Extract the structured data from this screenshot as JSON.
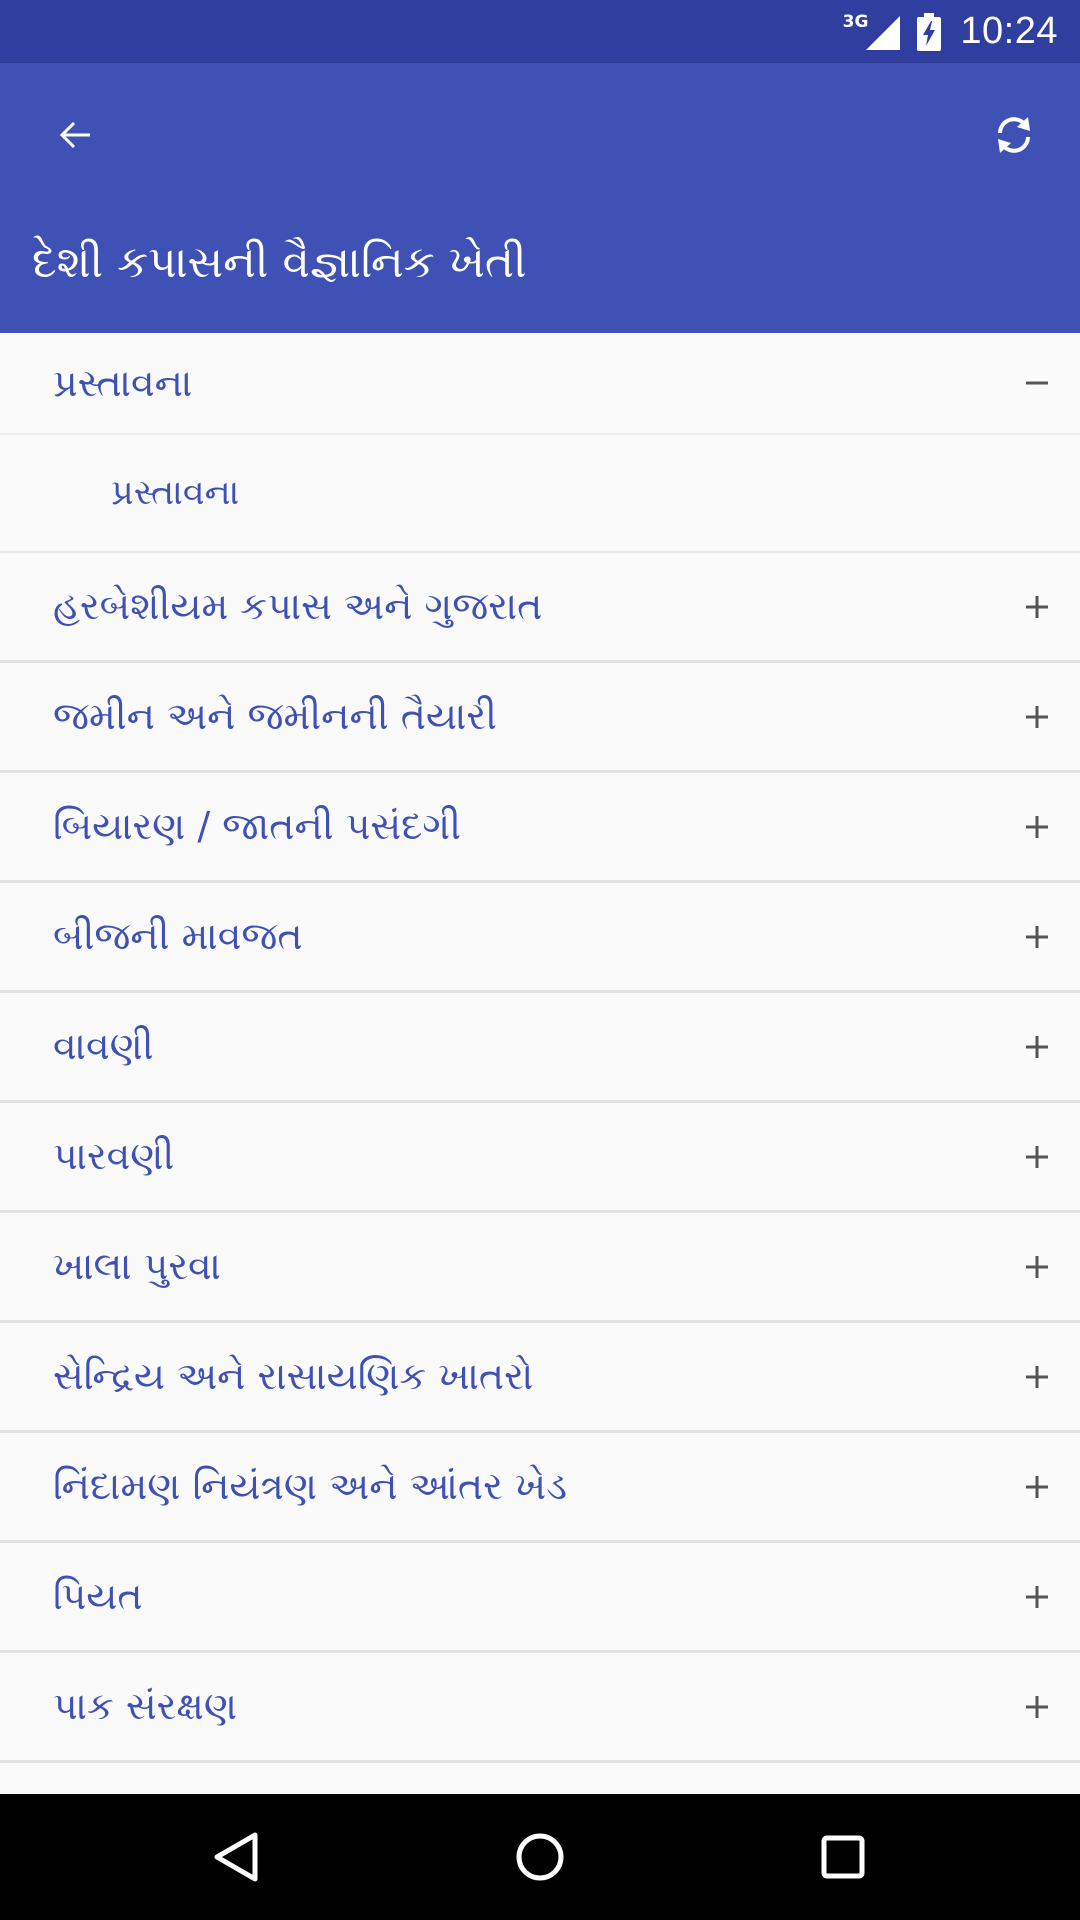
{
  "status_bar": {
    "network_type": "3G",
    "time": "10:24",
    "icons": [
      "signal-icon",
      "battery-charging-icon"
    ]
  },
  "app_bar": {
    "title": "દેશી કપાસની વૈજ્ઞાનિક ખેતી",
    "back_icon": "arrow-left-icon",
    "refresh_icon": "refresh-icon"
  },
  "list": {
    "groups": [
      {
        "label": "પ્રસ્તાવના",
        "expanded": true,
        "toggle": "−",
        "children": [
          "પ્રસ્તાવના"
        ]
      },
      {
        "label": "હરબેશીયમ કપાસ અને ગુજરાત",
        "expanded": false,
        "toggle": "+"
      },
      {
        "label": "જમીન અને જમીનની તૈયારી",
        "expanded": false,
        "toggle": "+"
      },
      {
        "label": "બિયારણ / જાતની પસંદગી",
        "expanded": false,
        "toggle": "+"
      },
      {
        "label": "બીજની માવજત",
        "expanded": false,
        "toggle": "+"
      },
      {
        "label": "વાવણી",
        "expanded": false,
        "toggle": "+"
      },
      {
        "label": "પારવણી",
        "expanded": false,
        "toggle": "+"
      },
      {
        "label": "ખાલા પુરવા",
        "expanded": false,
        "toggle": "+"
      },
      {
        "label": "સેન્દ્રિય અને રાસાયણિક ખાતરો",
        "expanded": false,
        "toggle": "+"
      },
      {
        "label": "નિંદામણ નિયંત્રણ અને આંતર ખેડ",
        "expanded": false,
        "toggle": "+"
      },
      {
        "label": "પિયત",
        "expanded": false,
        "toggle": "+"
      },
      {
        "label": "પાક સંરક્ષણ",
        "expanded": false,
        "toggle": "+"
      }
    ]
  },
  "nav_bar": {
    "icons": [
      "nav-back-icon",
      "nav-home-icon",
      "nav-recents-icon"
    ]
  },
  "colors": {
    "status_bar": "#303f9f",
    "app_bar": "#3f51b5",
    "list_text": "#3f51b5",
    "background": "#fafafa",
    "nav_bar": "#000000"
  }
}
